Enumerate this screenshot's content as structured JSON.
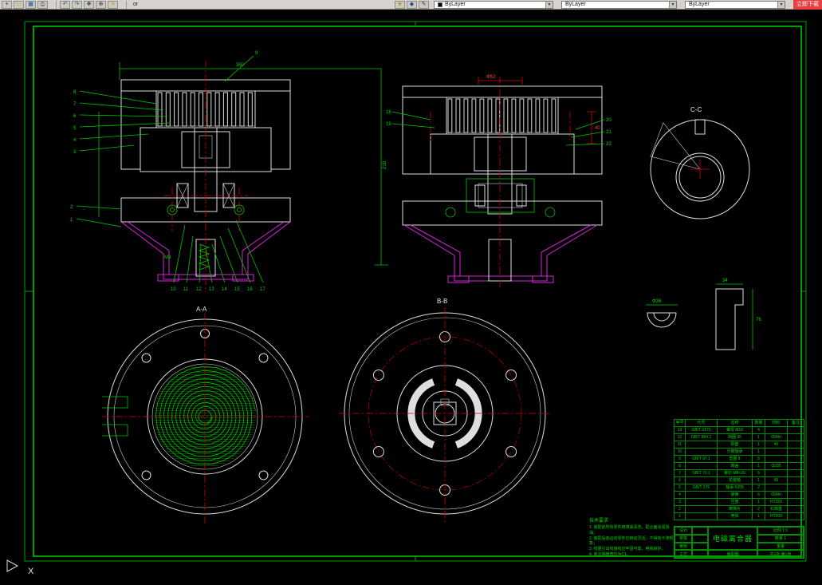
{
  "toolbar": {
    "icons_file": [
      {
        "name": "new-file-icon",
        "glyph": "+",
        "cls": ""
      },
      {
        "name": "open-icon",
        "glyph": "▭",
        "cls": "y"
      },
      {
        "name": "save-icon",
        "glyph": "▦",
        "cls": "b"
      },
      {
        "name": "print-icon",
        "glyph": "⎙",
        "cls": ""
      }
    ],
    "icons_edit": [
      {
        "name": "undo-icon",
        "glyph": "↶",
        "cls": "b"
      },
      {
        "name": "redo-icon",
        "glyph": "↷",
        "cls": "b"
      },
      {
        "name": "pan-icon",
        "glyph": "✥",
        "cls": ""
      },
      {
        "name": "zoom-icon",
        "glyph": "⊕",
        "cls": ""
      },
      {
        "name": "layers-icon",
        "glyph": "≡",
        "cls": "y"
      }
    ],
    "icons_props": [
      {
        "name": "star-icon",
        "glyph": "★",
        "cls": "y"
      },
      {
        "name": "properties-icon",
        "glyph": "◆",
        "cls": "b"
      },
      {
        "name": "matchprop-icon",
        "glyph": "✎",
        "cls": ""
      }
    ],
    "partial_text": "or",
    "color_combo": "ByLayer",
    "linetype_combo": "ByLayer",
    "lineweight_combo": "ByLayer",
    "promo_button": "立即下载"
  },
  "drawing": {
    "section_labels": {
      "viewA": "A-A",
      "viewB": "B-B",
      "viewC": "C-C"
    },
    "view1": {
      "dim_top": "350",
      "dim_right": "218",
      "callouts_left": [
        "8",
        "7",
        "6",
        "5",
        "4",
        "3"
      ],
      "callouts_left2": [
        "2",
        "1"
      ],
      "callout_top": "9",
      "callouts_bottom": [
        "10",
        "11",
        "12",
        "13",
        "14",
        "15",
        "16",
        "17"
      ],
      "spring_mark": "M8"
    },
    "view2": {
      "dim_top": "Φ52",
      "dim_right": "40",
      "callouts_left": [
        "18",
        "19"
      ],
      "callouts_right": [
        "20",
        "21",
        "22"
      ]
    },
    "view4": {
      "dim": "Φ36"
    },
    "view5": {
      "dim_w": "34",
      "dim_h": "76"
    }
  },
  "notes": {
    "title": "技术要求",
    "lines": [
      "1. 装配前所有零件用煤油清洗，配合面涂润滑油；",
      "2. 装配后各运动零件应转动灵活，不得有卡滞现象；",
      "3. 线圈引出线接线应牢固可靠，绝缘良好；",
      "4. 未注明倒角均为C1。"
    ]
  },
  "parts_table": {
    "headers": [
      "序号",
      "代号",
      "名称",
      "数量",
      "材料",
      "备注"
    ],
    "rows": [
      [
        "13",
        "GB/T 6170",
        "螺母 M10",
        "4",
        "",
        ""
      ],
      [
        "12",
        "GB/T 894.1",
        "挡圈 35",
        "1",
        "65Mn",
        ""
      ],
      [
        "11",
        "",
        "隔套",
        "1",
        "45",
        ""
      ],
      [
        "10",
        "",
        "分离轴承",
        "1",
        "",
        ""
      ],
      [
        "9",
        "GB/T 97.1",
        "垫圈 8",
        "6",
        "",
        ""
      ],
      [
        "8",
        "",
        "端盖",
        "1",
        "Q235",
        ""
      ],
      [
        "7",
        "GB/T 70.1",
        "螺钉 M8×20",
        "6",
        "",
        ""
      ],
      [
        "6",
        "",
        "花键轴",
        "1",
        "45",
        ""
      ],
      [
        "5",
        "GB/T 276",
        "轴承 6205",
        "2",
        "",
        ""
      ],
      [
        "4",
        "",
        "弹簧",
        "6",
        "65Mn",
        ""
      ],
      [
        "3",
        "",
        "压盘",
        "1",
        "HT250",
        ""
      ],
      [
        "2",
        "",
        "摩擦片",
        "2",
        "石棉基",
        ""
      ],
      [
        "1",
        "",
        "壳体",
        "1",
        "HT200",
        ""
      ]
    ]
  },
  "title_block": {
    "design": "设计",
    "check": "校核",
    "audit": "审核",
    "process": "工艺",
    "title": "电磁离合器",
    "doc": "装配图",
    "scale": "比例 1:1",
    "qty": "数量 1",
    "weight": "重量",
    "sheet": "共1张 第1张"
  },
  "ucs": {
    "x_label": "X"
  }
}
